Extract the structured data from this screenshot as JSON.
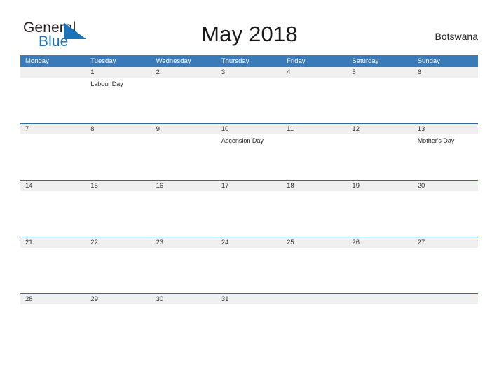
{
  "brand": {
    "word_one": "General",
    "word_two": "Blue",
    "accent_color": "#1b72b8",
    "triangle_icon": "blue-triangle-icon"
  },
  "header": {
    "title": "May 2018",
    "country": "Botswana"
  },
  "theme": {
    "header_blue": "#3a7ab8",
    "rule_blue": "#2e6da4",
    "date_band_gray": "#f0f0f0",
    "text_dark": "#231f20"
  },
  "calendar": {
    "month": "May",
    "year": "2018",
    "weekday_headers": [
      "Monday",
      "Tuesday",
      "Wednesday",
      "Thursday",
      "Friday",
      "Saturday",
      "Sunday"
    ],
    "weeks": [
      {
        "ruled": false,
        "days": [
          {
            "date": "",
            "event": ""
          },
          {
            "date": "1",
            "event": "Labour Day"
          },
          {
            "date": "2",
            "event": ""
          },
          {
            "date": "3",
            "event": ""
          },
          {
            "date": "4",
            "event": ""
          },
          {
            "date": "5",
            "event": ""
          },
          {
            "date": "6",
            "event": ""
          }
        ]
      },
      {
        "ruled": true,
        "days": [
          {
            "date": "7",
            "event": ""
          },
          {
            "date": "8",
            "event": ""
          },
          {
            "date": "9",
            "event": ""
          },
          {
            "date": "10",
            "event": "Ascension Day"
          },
          {
            "date": "11",
            "event": ""
          },
          {
            "date": "12",
            "event": ""
          },
          {
            "date": "13",
            "event": "Mother's Day"
          }
        ]
      },
      {
        "ruled": true,
        "days": [
          {
            "date": "14",
            "event": ""
          },
          {
            "date": "15",
            "event": ""
          },
          {
            "date": "16",
            "event": ""
          },
          {
            "date": "17",
            "event": ""
          },
          {
            "date": "18",
            "event": ""
          },
          {
            "date": "19",
            "event": ""
          },
          {
            "date": "20",
            "event": ""
          }
        ]
      },
      {
        "ruled": true,
        "days": [
          {
            "date": "21",
            "event": ""
          },
          {
            "date": "22",
            "event": ""
          },
          {
            "date": "23",
            "event": ""
          },
          {
            "date": "24",
            "event": ""
          },
          {
            "date": "25",
            "event": ""
          },
          {
            "date": "26",
            "event": ""
          },
          {
            "date": "27",
            "event": ""
          }
        ]
      },
      {
        "ruled": true,
        "days": [
          {
            "date": "28",
            "event": ""
          },
          {
            "date": "29",
            "event": ""
          },
          {
            "date": "30",
            "event": ""
          },
          {
            "date": "31",
            "event": ""
          },
          {
            "date": "",
            "event": ""
          },
          {
            "date": "",
            "event": ""
          },
          {
            "date": "",
            "event": ""
          }
        ]
      }
    ]
  }
}
